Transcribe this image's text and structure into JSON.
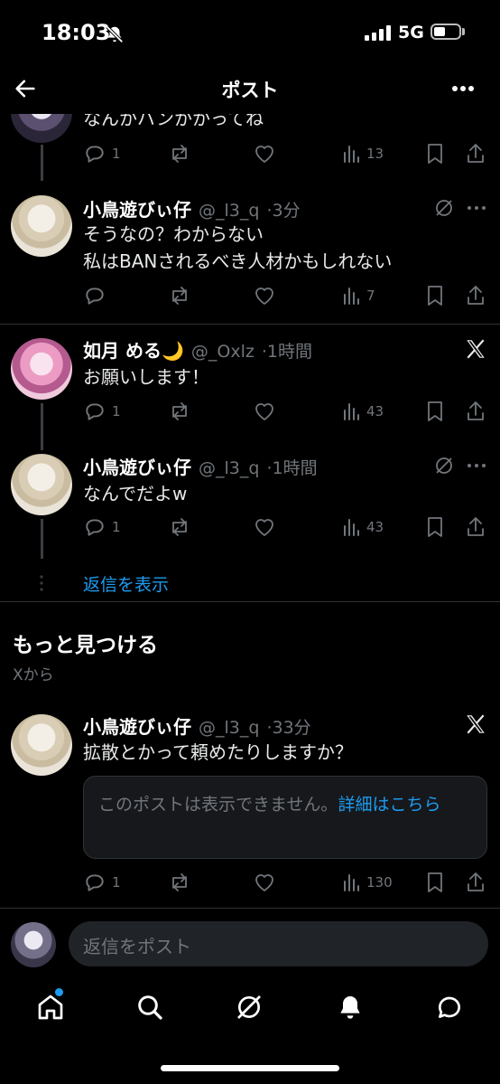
{
  "status_bar": {
    "time": "18:03",
    "network": "5G"
  },
  "header": {
    "title": "ポスト"
  },
  "posts": [
    {
      "text": "なんかバンかかってね",
      "actions": {
        "replies": "1",
        "views": "13"
      }
    },
    {
      "name": "小鳥遊びぃ仔",
      "handle": "@_l3_q",
      "time": "3分",
      "text_lines": [
        "そうなの？わからない",
        "私はBANされるべき人材かもしれない"
      ],
      "actions": {
        "replies": "",
        "views": "7"
      }
    },
    {
      "name": "如月 める🌙",
      "handle": "@_Oxlz",
      "time": "1時間",
      "text": "お願いします！",
      "actions": {
        "replies": "1",
        "views": "43"
      }
    },
    {
      "name": "小鳥遊びぃ仔",
      "handle": "@_l3_q",
      "time": "1時間",
      "text": "なんでだよw",
      "actions": {
        "replies": "1",
        "views": "43"
      }
    }
  ],
  "show_replies": "返信を表示",
  "discover": {
    "title": "もっと見つける",
    "subtitle": "Xから",
    "post": {
      "name": "小鳥遊びぃ仔",
      "handle": "@_l3_q",
      "time": "33分",
      "text": "拡散とかって頼めたりしますか？",
      "notice": "このポストは表示できません。",
      "notice_link": "詳細はこちら",
      "actions": {
        "replies": "1",
        "views": "130"
      }
    }
  },
  "reply": {
    "placeholder": "返信をポスト"
  },
  "colors": {
    "accent": "#1d9bf0",
    "background": "#000000",
    "muted": "#71767b"
  }
}
